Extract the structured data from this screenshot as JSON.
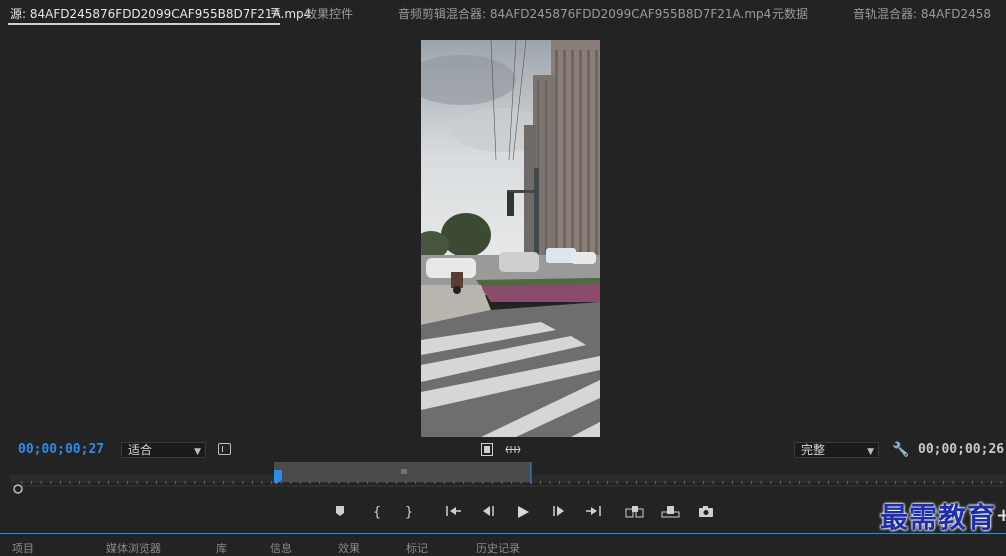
{
  "tabs": [
    {
      "label": "源: 84AFD245876FDD2099CAF955B8D7F21A.mp4",
      "active": true
    },
    {
      "label": "效果控件",
      "active": false
    },
    {
      "label": "音频剪辑混合器: 84AFD245876FDD2099CAF955B8D7F21A.mp4",
      "active": false
    },
    {
      "label": "元数据",
      "active": false
    },
    {
      "label": "音轨混合器: 84AFD2458",
      "active": false
    }
  ],
  "panel_menu_icon": "hamburger-menu-icon",
  "controls": {
    "current_timecode": "00;00;00;27",
    "zoom_select": "适合",
    "resolution_select": "完整",
    "duration_timecode": "00;00;00;26"
  },
  "playhead_fraction": 0.262,
  "bottom_tabs": [
    "项目",
    "媒体浏览器",
    "库",
    "信息",
    "效果",
    "标记",
    "历史记录"
  ],
  "watermark": "最需教育",
  "colors": {
    "accent": "#2d8ceb",
    "background": "#232323"
  }
}
